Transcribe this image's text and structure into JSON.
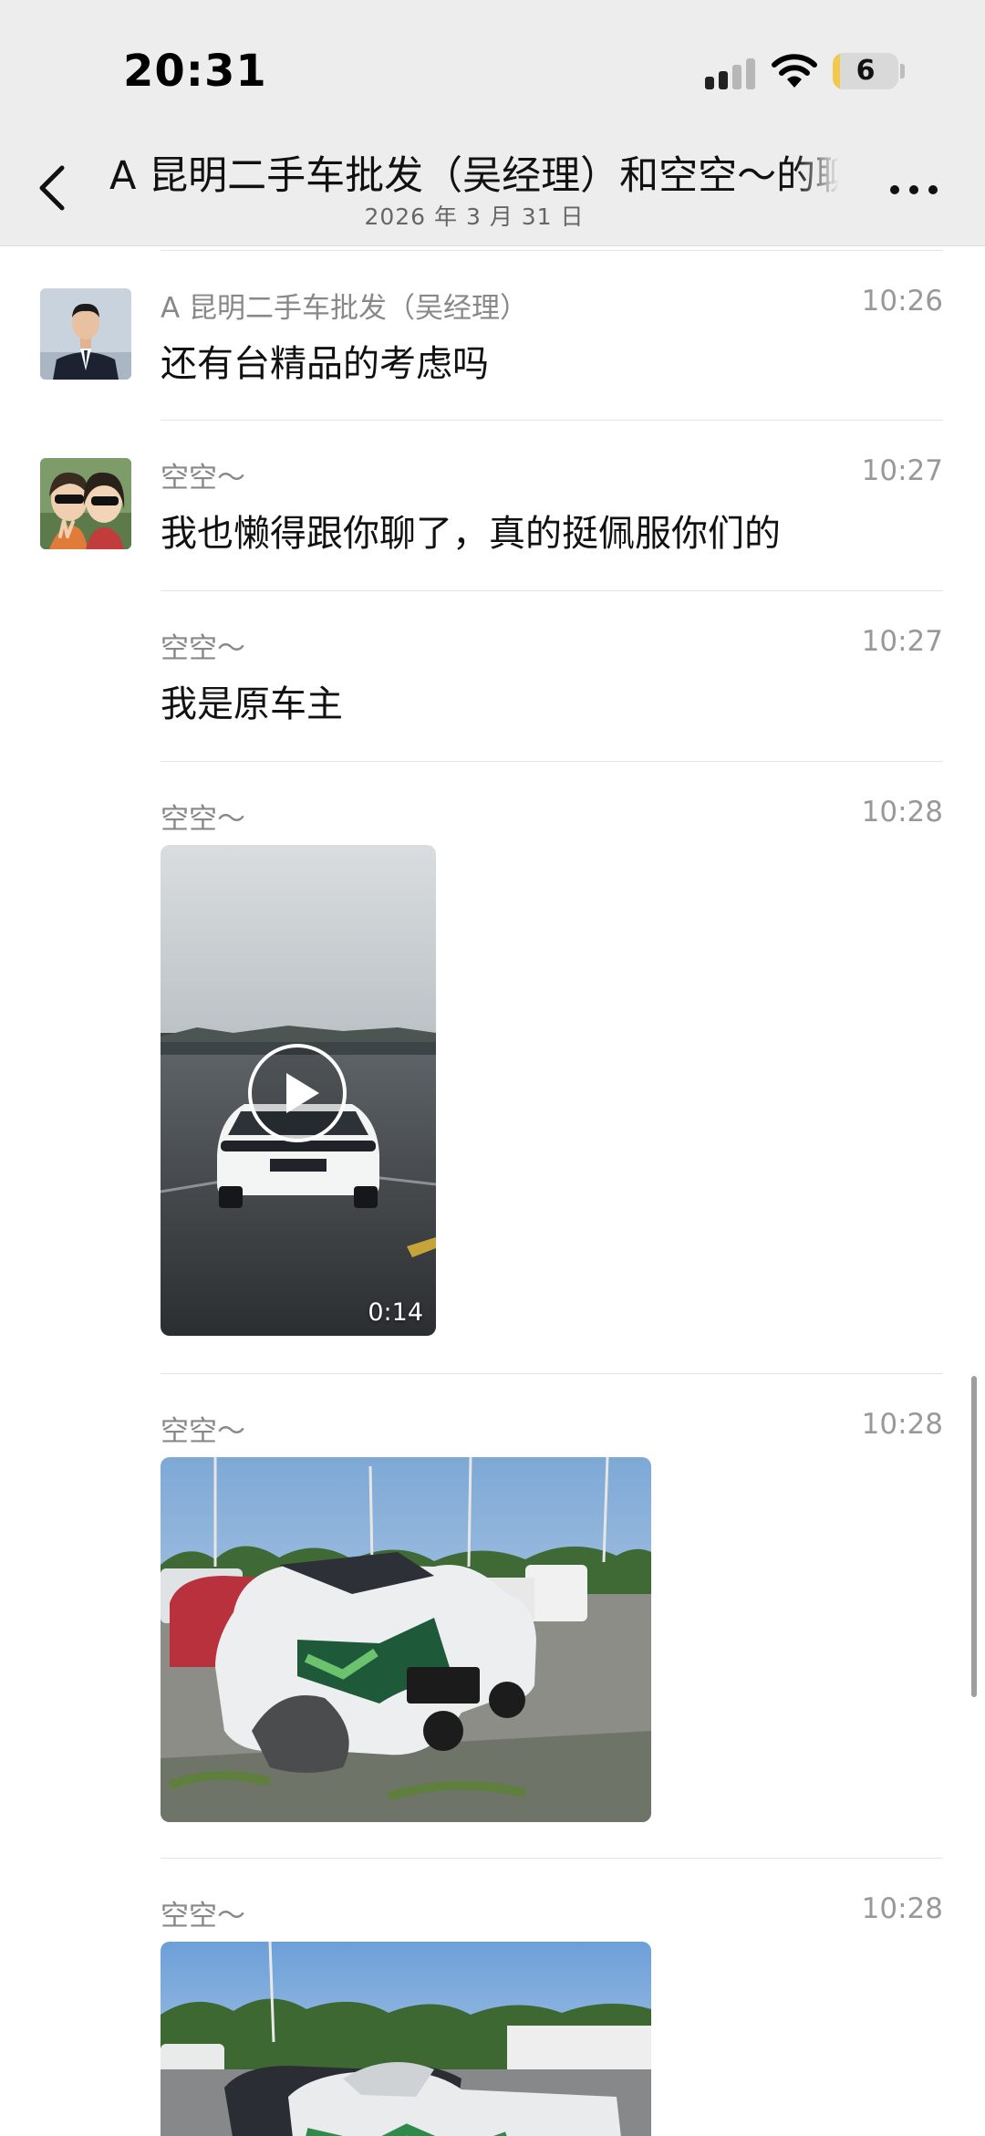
{
  "status_bar": {
    "time": "20:31",
    "battery": "6"
  },
  "nav": {
    "title": "A 昆明二手车批发（吴经理）和空空～的聊天记录",
    "subtitle": "2026 年 3 月 31 日"
  },
  "messages": [
    {
      "sender": "A 昆明二手车批发（吴经理）",
      "time": "10:26",
      "text": "还有台精品的考虑吗"
    },
    {
      "sender": "空空～",
      "time": "10:27",
      "text": "我也懒得跟你聊了，真的挺佩服你们的"
    },
    {
      "sender": "空空～",
      "time": "10:27",
      "text": "我是原车主"
    },
    {
      "sender": "空空～",
      "time": "10:28",
      "video_duration": "0:14"
    },
    {
      "sender": "空空～",
      "time": "10:28"
    },
    {
      "sender": "空空～",
      "time": "10:28"
    }
  ],
  "colors": {
    "header_bg": "#ededed",
    "text_primary": "#111111",
    "text_secondary": "#888888",
    "battery_accent": "#f2c94c"
  }
}
